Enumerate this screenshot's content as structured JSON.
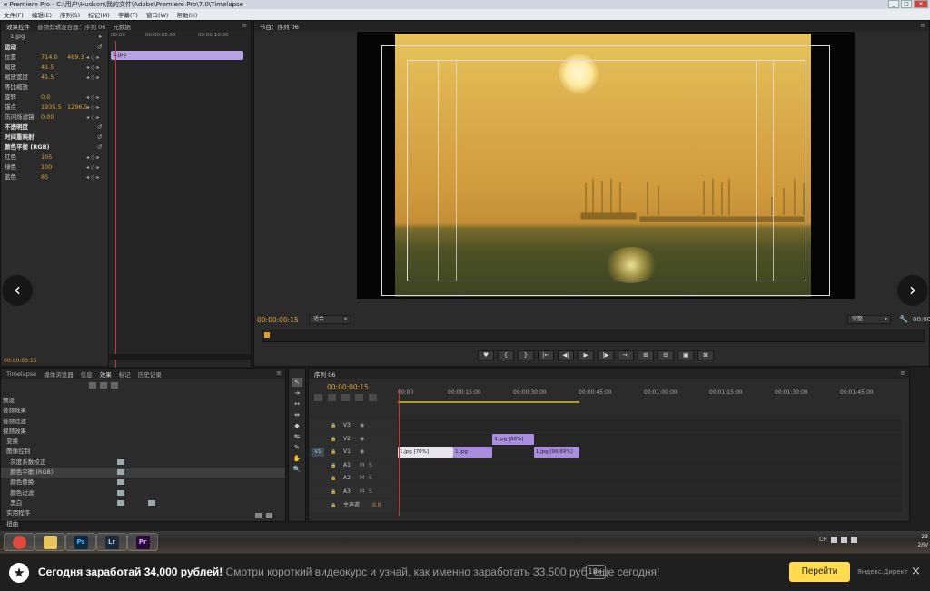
{
  "window": {
    "title": "e Premiere Pro - C:\\用户\\Hudson\\我的文件\\Adobe\\Premiere Pro\\7.0\\Timelapse",
    "buttons": [
      "_",
      "□",
      "✕"
    ]
  },
  "menu": [
    "文件(F)",
    "编辑(E)",
    "序列(S)",
    "标记(M)",
    "字幕(T)",
    "窗口(W)",
    "帮助(H)"
  ],
  "effect_controls": {
    "tabs": [
      "效果控件",
      "音频剪辑混合器：序列 06",
      "元数据"
    ],
    "clip_name": "1.jpg",
    "timeline_clip": "1.jpg",
    "ruler": [
      "00:00",
      "00:00:05:00",
      "00:00:10:00"
    ],
    "rows": [
      {
        "label": "运动",
        "v1": "",
        "v2": "",
        "bold": true
      },
      {
        "label": "位置",
        "v1": "714.0",
        "v2": "469.3"
      },
      {
        "label": "缩放",
        "v1": "41.5",
        "v2": ""
      },
      {
        "label": "缩放宽度",
        "v1": "41.5",
        "v2": ""
      },
      {
        "label": "等比缩放",
        "v1": "",
        "v2": ""
      },
      {
        "label": "旋转",
        "v1": "0.0",
        "v2": ""
      },
      {
        "label": "锚点",
        "v1": "1935.5",
        "v2": "1296.5"
      },
      {
        "label": "防闪烁滤镜",
        "v1": "0.00",
        "v2": ""
      },
      {
        "label": "不透明度",
        "v1": "",
        "v2": "",
        "bold": true
      },
      {
        "label": "时间重映射",
        "v1": "",
        "v2": "",
        "bold": true
      },
      {
        "label": "颜色平衡 (RGB)",
        "v1": "",
        "v2": "",
        "bold": true
      },
      {
        "label": "红色",
        "v1": "105",
        "v2": ""
      },
      {
        "label": "绿色",
        "v1": "100",
        "v2": ""
      },
      {
        "label": "蓝色",
        "v1": "85",
        "v2": ""
      }
    ],
    "bottom_time": "00:00:00:15"
  },
  "program_monitor": {
    "tab": "节目：序列 06",
    "timecode": "00:00:00:15",
    "fit": "适合",
    "quality": "完整",
    "end_time": "00:00",
    "controls": [
      "♥",
      "{",
      "}",
      "|←",
      "◀|",
      "▶",
      "|▶",
      "→|",
      "⊞",
      "⊟",
      "▣",
      "⊠"
    ]
  },
  "effects_panel": {
    "tabs": [
      "Timelapse",
      "媒体浏览器",
      "信息",
      "效果",
      "标记",
      "历史记录"
    ],
    "items": [
      {
        "label": "预设",
        "ico": false
      },
      {
        "label": "音频效果",
        "ico": false
      },
      {
        "label": "音频过渡",
        "ico": false
      },
      {
        "label": "视频效果",
        "ico": false
      },
      {
        "label": "  变换",
        "ico": false
      },
      {
        "label": "  图像控制",
        "ico": false
      },
      {
        "label": "    灰度系数校正",
        "ico": true
      },
      {
        "label": "    颜色平衡 (RGB)",
        "ico": true,
        "sel": true
      },
      {
        "label": "    颜色替换",
        "ico": true
      },
      {
        "label": "    颜色过滤",
        "ico": true
      },
      {
        "label": "    黑白",
        "ico": true,
        "ico2": true
      },
      {
        "label": "  实用程序",
        "ico": false
      },
      {
        "label": "  扭曲",
        "ico": false
      }
    ]
  },
  "tools": [
    "↖",
    "⇥",
    "↔",
    "⇹",
    "◆",
    "↹",
    "✎",
    "✋",
    "🔍"
  ],
  "timeline": {
    "tab": "序列 06",
    "timecode": "00:00:00:15",
    "ruler": [
      "00:00",
      "00:00:15:00",
      "00:00:30:00",
      "00:00:45:00",
      "00:01:00:00",
      "00:01:15:00",
      "00:01:30:00",
      "00:01:45:00"
    ],
    "tracks": [
      {
        "name": "V3",
        "target": "",
        "clips": []
      },
      {
        "name": "V2",
        "target": "",
        "clips": [
          {
            "label": "1.jpg [88%]",
            "style": "purple",
            "start": 0.188,
            "end": 0.27
          }
        ]
      },
      {
        "name": "V1",
        "target": "V1",
        "clips": [
          {
            "label": "1.jpg [70%]",
            "style": "light",
            "start": 0.0,
            "end": 0.11
          },
          {
            "label": "1.jpg",
            "style": "purple",
            "start": 0.11,
            "end": 0.188
          },
          {
            "label": "1.jpg [99.89%]",
            "style": "purple",
            "start": 0.27,
            "end": 0.36
          }
        ]
      },
      {
        "name": "A1",
        "target": "",
        "clips": [],
        "audio": true
      },
      {
        "name": "A2",
        "target": "",
        "clips": [],
        "audio": true
      },
      {
        "name": "A3",
        "target": "",
        "clips": [],
        "audio": true
      },
      {
        "name": "主声道",
        "target": "",
        "clips": [],
        "master": true,
        "value": "0.0"
      }
    ]
  },
  "taskbar": {
    "apps": [
      {
        "name": "chrome-icon",
        "label": "",
        "bg": "#e04a3c",
        "color": "#fff"
      },
      {
        "name": "explorer-icon",
        "label": "",
        "bg": "#e6c45a",
        "color": "#333"
      },
      {
        "name": "photoshop-icon",
        "label": "Ps",
        "bg": "#0a2a44",
        "color": "#4fb5f5"
      },
      {
        "name": "lightroom-icon",
        "label": "Lr",
        "bg": "#1a2a3a",
        "color": "#a7c3e0"
      },
      {
        "name": "premiere-icon",
        "label": "Pr",
        "bg": "#2a0a3a",
        "color": "#e0a8ff"
      }
    ],
    "tray_text": "CH",
    "clock_time": "23",
    "clock_date": "2/9/"
  },
  "ad": {
    "headline": "Сегодня заработай 34,000 рублей!",
    "body": " Смотри короткий видеокурс и узнай, как именно заработать 33,500 руб. еще сегодня!",
    "age": "18+",
    "cta": "Перейти",
    "source": "Яндекс.Директ",
    "close": "×"
  },
  "nav": {
    "prev": "‹",
    "next": "›"
  }
}
